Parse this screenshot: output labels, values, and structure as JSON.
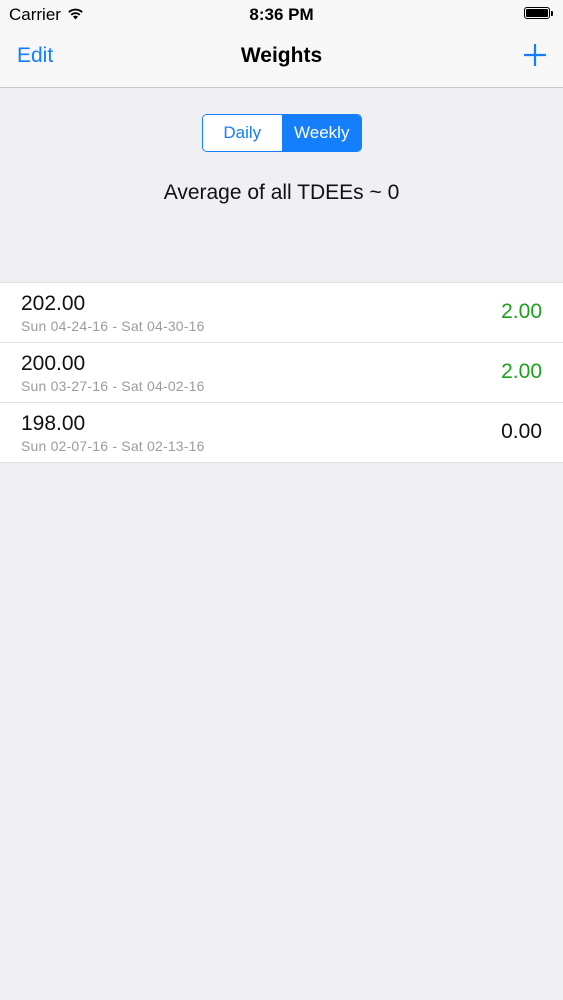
{
  "status_bar": {
    "carrier": "Carrier",
    "time": "8:36 PM",
    "wifi_icon": "wifi-icon",
    "battery_icon": "battery-icon",
    "battery_level": 1.0
  },
  "nav": {
    "edit_label": "Edit",
    "title": "Weights",
    "add_icon": "plus-icon"
  },
  "segmented": {
    "options": [
      "Daily",
      "Weekly"
    ],
    "selected": "Weekly"
  },
  "average_text": "Average of all TDEEs ~ 0",
  "rows": [
    {
      "weight": "202.00",
      "range": "Sun 04-24-16 - Sat 04-30-16",
      "value": "2.00",
      "value_color": "#1ba11b"
    },
    {
      "weight": "200.00",
      "range": "Sun 03-27-16 - Sat 04-02-16",
      "value": "2.00",
      "value_color": "#1ba11b"
    },
    {
      "weight": "198.00",
      "range": "Sun 02-07-16 - Sat 02-13-16",
      "value": "0.00",
      "value_color": "#111111"
    }
  ],
  "colors": {
    "accent": "#157efb",
    "background": "#efeff4",
    "positive": "#1ba11b"
  }
}
